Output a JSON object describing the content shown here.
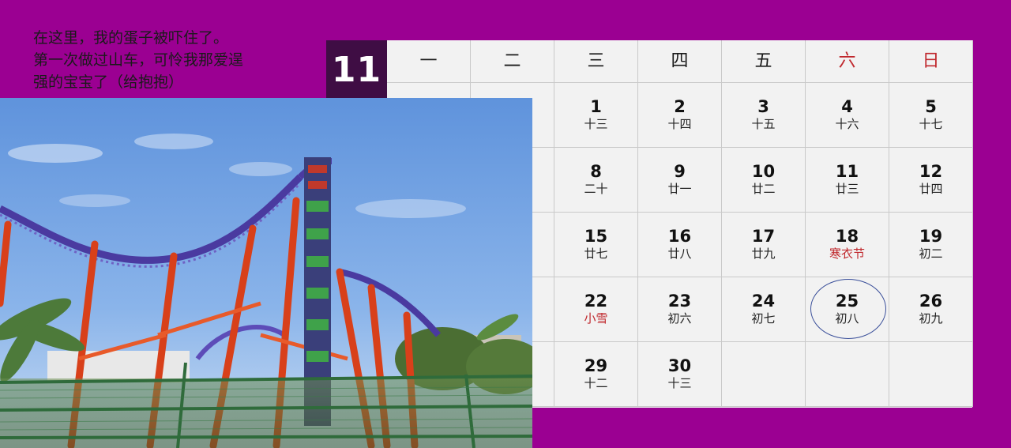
{
  "caption": {
    "line1": "在这里，我的蛋子被吓住了。",
    "line2": "第一次做过山车，可怜我那爱逞",
    "line3": "强的宝宝了（给抱抱）"
  },
  "calendar": {
    "month": "11",
    "weekdays": [
      "一",
      "二",
      "三",
      "四",
      "五",
      "六",
      "日"
    ],
    "weekend_color": "#c0282d",
    "highlighted_day": "25",
    "rows": [
      [
        {
          "day": "1",
          "lunar": "十三"
        },
        {
          "day": "2",
          "lunar": "十四"
        },
        {
          "day": "3",
          "lunar": "十五"
        },
        {
          "day": "4",
          "lunar": "十六"
        },
        {
          "day": "5",
          "lunar": "十七"
        }
      ],
      [
        {
          "day": "8",
          "lunar": "二十"
        },
        {
          "day": "9",
          "lunar": "廿一"
        },
        {
          "day": "10",
          "lunar": "廿二"
        },
        {
          "day": "11",
          "lunar": "廿三"
        },
        {
          "day": "12",
          "lunar": "廿四"
        }
      ],
      [
        {
          "day": "15",
          "lunar": "廿七"
        },
        {
          "day": "16",
          "lunar": "廿八"
        },
        {
          "day": "17",
          "lunar": "廿九"
        },
        {
          "day": "18",
          "lunar": "寒衣节",
          "festival": true
        },
        {
          "day": "19",
          "lunar": "初二"
        }
      ],
      [
        {
          "day": "22",
          "lunar": "小雪",
          "festival": true
        },
        {
          "day": "23",
          "lunar": "初六"
        },
        {
          "day": "24",
          "lunar": "初七"
        },
        {
          "day": "25",
          "lunar": "初八",
          "highlight": true
        },
        {
          "day": "26",
          "lunar": "初九"
        }
      ],
      [
        {
          "day": "29",
          "lunar": "十二"
        },
        {
          "day": "30",
          "lunar": "十三"
        }
      ]
    ]
  },
  "colors": {
    "background": "#9b0092",
    "month_badge": "#3f0d44",
    "grid": "#f2f2f2"
  },
  "photo": {
    "icon": "roller-coaster-photo"
  }
}
